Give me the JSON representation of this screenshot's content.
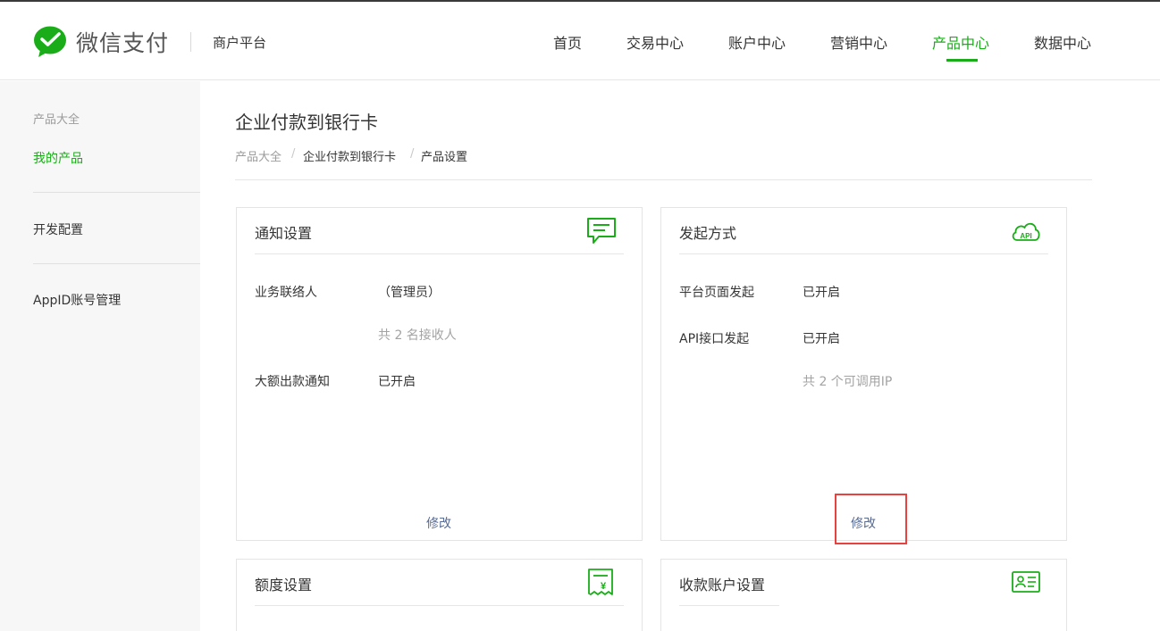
{
  "brand": {
    "name": "微信支付",
    "platform": "商户平台",
    "logo_icon": "wechat-pay-logo-icon"
  },
  "nav": {
    "items": [
      {
        "label": "首页",
        "active": false
      },
      {
        "label": "交易中心",
        "active": false
      },
      {
        "label": "账户中心",
        "active": false
      },
      {
        "label": "营销中心",
        "active": false
      },
      {
        "label": "产品中心",
        "active": true
      },
      {
        "label": "数据中心",
        "active": false
      }
    ]
  },
  "sidebar": {
    "items": [
      {
        "label": "产品大全"
      },
      {
        "label": "我的产品",
        "active": true
      },
      {
        "label": "开发配置"
      },
      {
        "label": "AppID账号管理"
      }
    ]
  },
  "page": {
    "title": "企业付款到银行卡",
    "breadcrumb": [
      "产品大全",
      "企业付款到银行卡",
      "产品设置"
    ],
    "breadcrumb_separator": "/"
  },
  "cards": {
    "notify": {
      "title": "通知设置",
      "icon": "message-icon",
      "rows": [
        {
          "label": "业务联络人",
          "value": "（管理员）"
        },
        {
          "note": "共 2 名接收人"
        },
        {
          "label": "大额出款通知",
          "value": "已开启"
        }
      ],
      "action": "修改"
    },
    "initiate": {
      "title": "发起方式",
      "icon": "cloud-api-icon",
      "icon_text": "API",
      "rows": [
        {
          "label": "平台页面发起",
          "value": "已开启"
        },
        {
          "label": "API接口发起",
          "value": "已开启"
        },
        {
          "note": "共 2 个可调用IP"
        }
      ],
      "action": "修改"
    },
    "quota": {
      "title": "额度设置",
      "icon": "receipt-yuan-icon",
      "icon_text": "¥"
    },
    "account": {
      "title": "收款账户设置",
      "icon": "id-card-icon"
    }
  },
  "colors": {
    "accent": "#1aad19",
    "link": "#576b95",
    "highlight": "#e64340"
  }
}
